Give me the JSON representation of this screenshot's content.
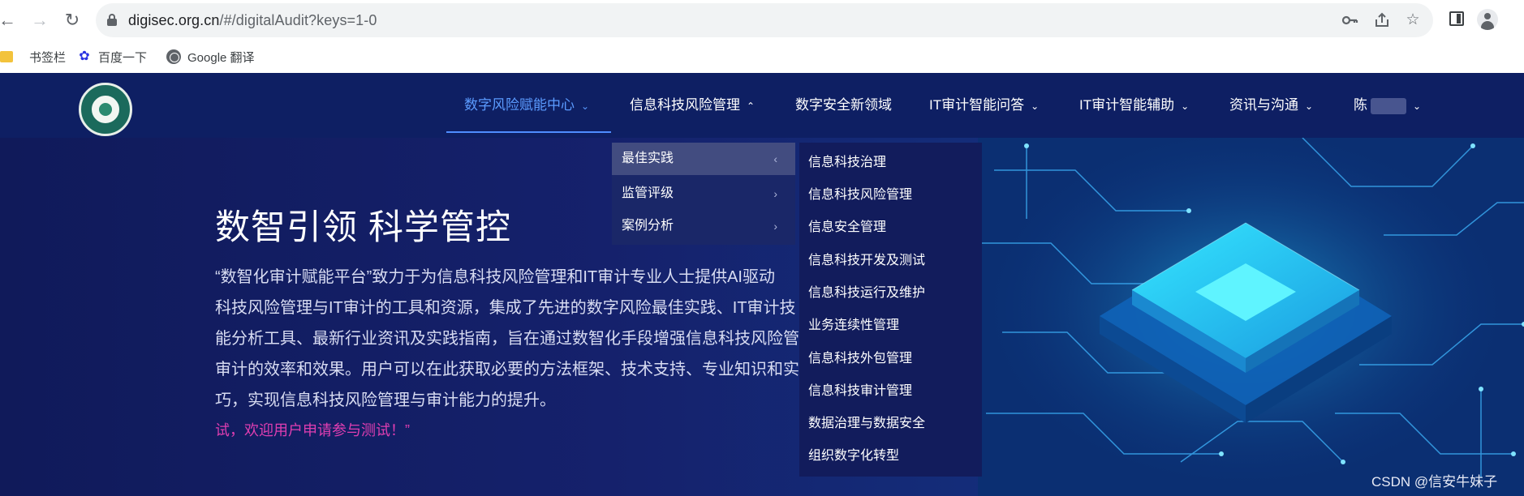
{
  "browser": {
    "url_domain": "digisec.org.cn",
    "url_path": "/#/digitalAudit?keys=1-0",
    "bookmarks": [
      {
        "label": "书签栏",
        "icon": "folder-icon"
      },
      {
        "label": "百度一下",
        "icon": "baidu-paw-icon"
      },
      {
        "label": "Google 翻译",
        "icon": "globe-icon"
      }
    ]
  },
  "nav": {
    "items": [
      {
        "label": "数字风险赋能中心",
        "chevron": "down",
        "active": true
      },
      {
        "label": "信息科技风险管理",
        "chevron": "up",
        "active": false
      },
      {
        "label": "数字安全新领域",
        "chevron": "",
        "active": false
      },
      {
        "label": "IT审计智能问答",
        "chevron": "down",
        "active": false
      },
      {
        "label": "IT审计智能辅助",
        "chevron": "down",
        "active": false
      },
      {
        "label": "资讯与沟通",
        "chevron": "down",
        "active": false
      },
      {
        "label": "陈",
        "chevron": "down",
        "active": false
      }
    ]
  },
  "hero": {
    "title": "数智引领  科学管控",
    "lines": [
      "“数智化审计赋能平台”致力于为信息科技风险管理和IT审计专业人士提供AI驱动",
      "科技风险管理与IT审计的工具和资源，集成了先进的数字风险最佳实践、IT审计技",
      "能分析工具、最新行业资讯及实践指南，旨在通过数智化手段增强信息科技风险管",
      "审计的效率和效果。用户可以在此获取必要的方法框架、技术支持、专业知识和实",
      "巧，实现信息科技风险管理与审计能力的提升。"
    ],
    "cta": "试，欢迎用户申请参与测试！”"
  },
  "dropdown_primary": [
    {
      "label": "最佳实践",
      "arrow": "‹",
      "hovered": true
    },
    {
      "label": "监管评级",
      "arrow": "›",
      "hovered": false
    },
    {
      "label": "案例分析",
      "arrow": "›",
      "hovered": false
    }
  ],
  "dropdown_secondary": [
    "信息科技治理",
    "信息科技风险管理",
    "信息安全管理",
    "信息科技开发及测试",
    "信息科技运行及维护",
    "业务连续性管理",
    "信息科技外包管理",
    "信息科技审计管理",
    "数据治理与数据安全",
    "组织数字化转型"
  ],
  "watermark": "CSDN @信安牛妹子",
  "colors": {
    "header_bg": "#0e1f63",
    "active_nav": "#5b9bff",
    "cta": "#e03eb1",
    "dropdown_hover": "#424c80"
  }
}
